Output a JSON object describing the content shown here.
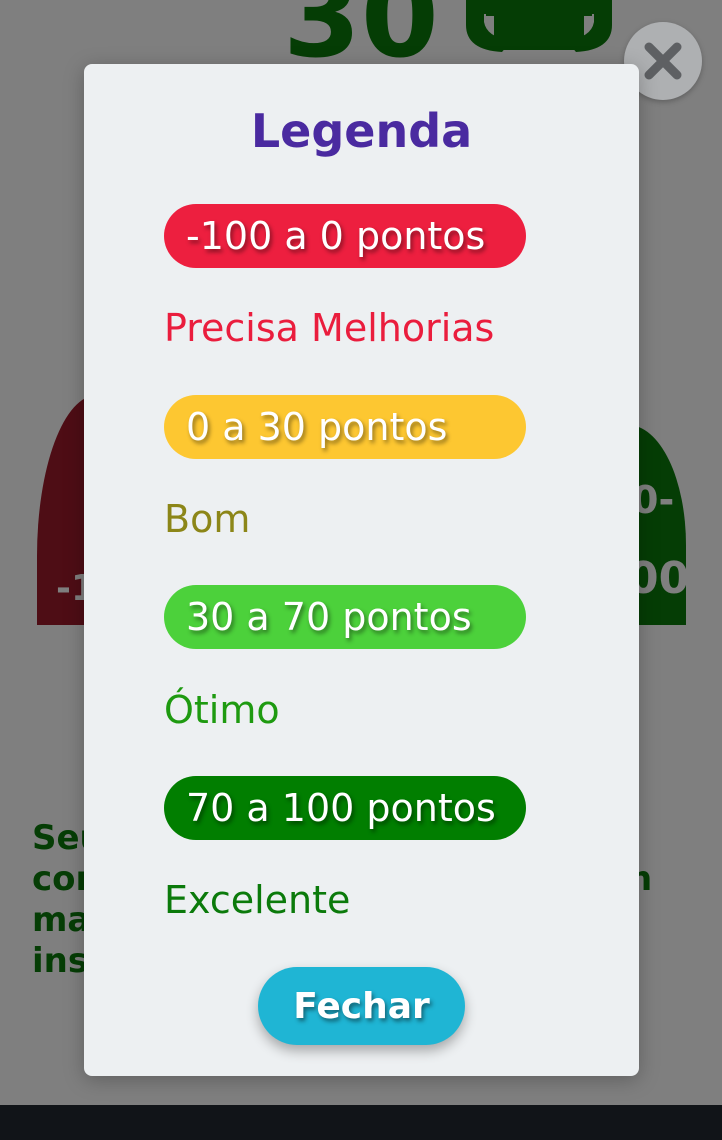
{
  "background": {
    "score": "30",
    "gauge_left_label": "-1",
    "gauge_right_top": "0-",
    "gauge_right_bottom": "00",
    "text_lines": [
      "Seu",
      "cor",
      "ma",
      "ins"
    ],
    "text_right": "n"
  },
  "modal": {
    "title": "Legenda",
    "close_label": "Fechar",
    "legend": [
      {
        "range": "-100 a 0 pontos",
        "label": "Precisa Melhorias",
        "pill_color": "#ed1f3f",
        "label_color": "#ea1d3d"
      },
      {
        "range": "0 a 30 pontos",
        "label": "Bom",
        "pill_color": "#fdc731",
        "label_color": "#8c8618"
      },
      {
        "range": "30 a 70 pontos",
        "label": "Ótimo",
        "pill_color": "#4cd13b",
        "label_color": "#1e9a10"
      },
      {
        "range": "70 a 100 pontos",
        "label": "Excelente",
        "pill_color": "#017e00",
        "label_color": "#0b7a0b"
      }
    ]
  },
  "colors": {
    "title": "#4a2aa0",
    "button": "#1fb5d4",
    "modal_bg": "#edf0f2"
  },
  "icons": {
    "trophy": "trophy-icon",
    "close": "close-icon"
  }
}
